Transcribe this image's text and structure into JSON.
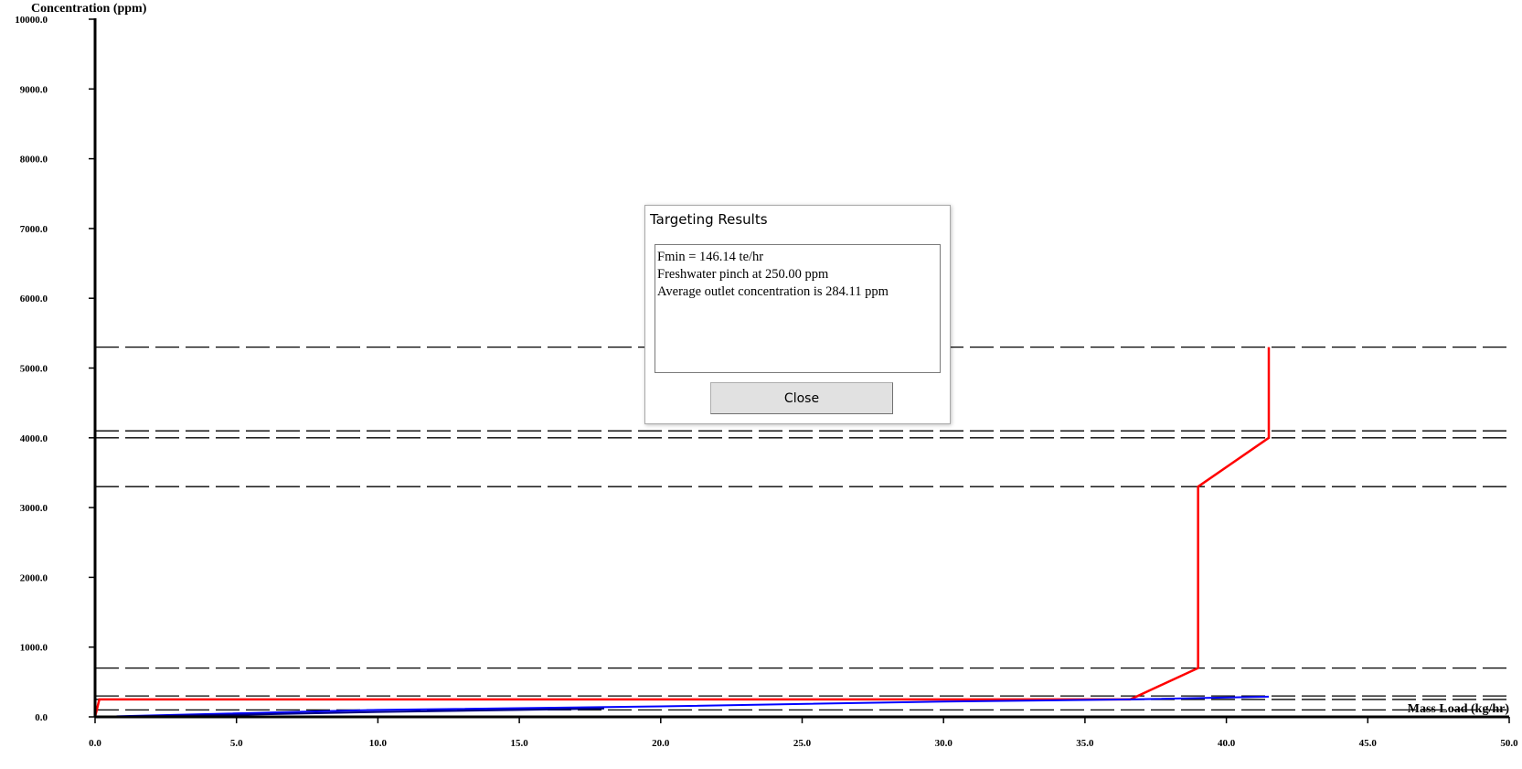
{
  "chart_data": {
    "type": "line",
    "ylabel": "Concentration (ppm)",
    "xlabel": "Mass Load (kg/hr)",
    "xlim": [
      0,
      50
    ],
    "ylim": [
      0,
      10000
    ],
    "x_ticks": [
      "0.0",
      "5.0",
      "10.0",
      "15.0",
      "20.0",
      "25.0",
      "30.0",
      "35.0",
      "40.0",
      "45.0",
      "50.0"
    ],
    "y_ticks": [
      "0.0",
      "1000.0",
      "2000.0",
      "3000.0",
      "4000.0",
      "5000.0",
      "6000.0",
      "7000.0",
      "8000.0",
      "9000.0",
      "10000.0"
    ],
    "interval_lines_ppm": [
      100,
      250,
      300,
      700,
      3300,
      4000,
      4100,
      5300
    ],
    "series": [
      {
        "color": "#ff0000",
        "points": [
          [
            0,
            0
          ],
          [
            0.15,
            250
          ],
          [
            36.6,
            250
          ],
          [
            39,
            700
          ],
          [
            39,
            3300
          ],
          [
            41.5,
            4000
          ],
          [
            41.5,
            4100
          ],
          [
            41.5,
            5300
          ]
        ]
      },
      {
        "color": "#0000ff",
        "points": [
          [
            0,
            0
          ],
          [
            10,
            100
          ],
          [
            20,
            150
          ],
          [
            30,
            220
          ],
          [
            36.6,
            250
          ],
          [
            41.5,
            290
          ]
        ]
      },
      {
        "color": "#000080",
        "points": [
          [
            0,
            0
          ],
          [
            5,
            30
          ],
          [
            10,
            70
          ],
          [
            15,
            100
          ],
          [
            18,
            120
          ]
        ]
      }
    ]
  },
  "dialog": {
    "title": "Targeting Results",
    "lines": [
      "Fmin = 146.14 te/hr",
      "Freshwater pinch at 250.00 ppm",
      "Average outlet concentration is 284.11 ppm"
    ],
    "close_label": "Close"
  }
}
